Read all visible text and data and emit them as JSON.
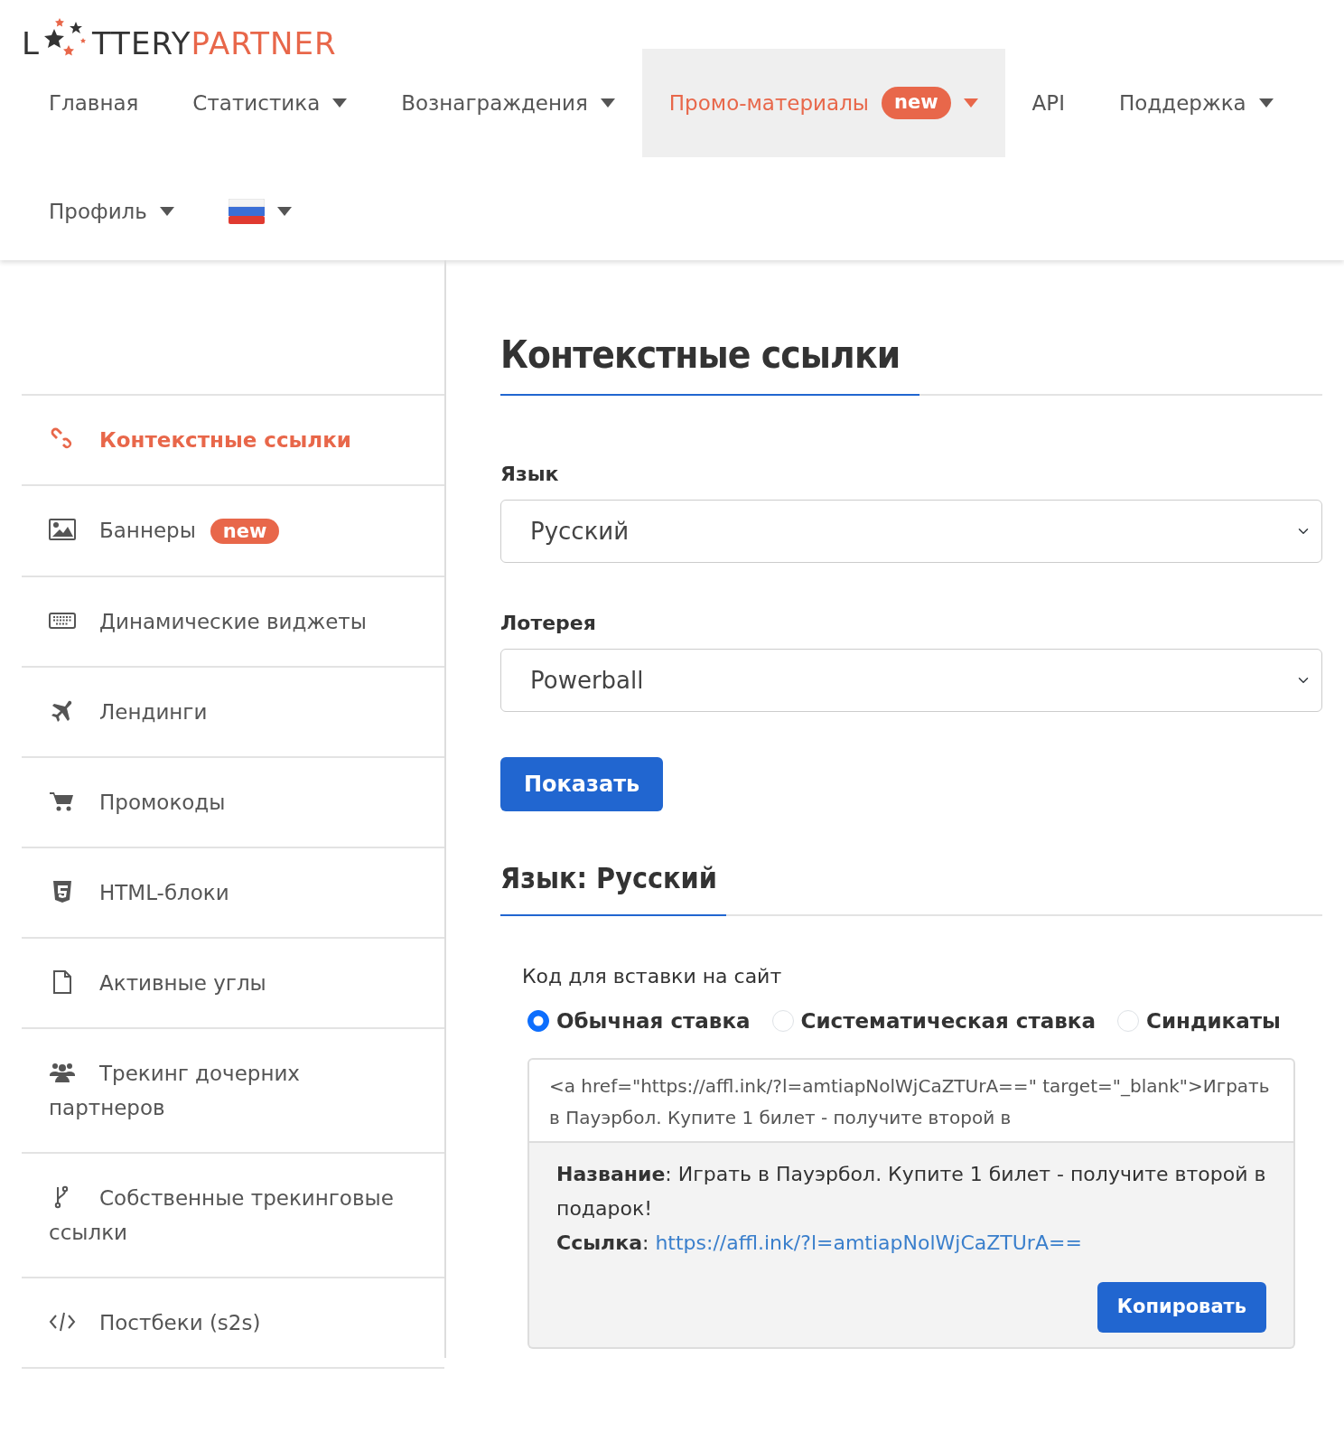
{
  "logo": {
    "part_1": "L",
    "part_2": "TTERY",
    "part_3": "PARTNER"
  },
  "nav": [
    {
      "kind": "text",
      "label": "Главная",
      "dropdown": false,
      "selected": false
    },
    {
      "kind": "text",
      "label": "Статистика",
      "dropdown": true,
      "selected": false
    },
    {
      "kind": "text",
      "label": "Вознаграждения",
      "dropdown": true,
      "selected": false
    },
    {
      "kind": "text",
      "label": "Промо-материалы",
      "badge": "new",
      "dropdown": true,
      "selected": true
    },
    {
      "kind": "text",
      "label": "API",
      "dropdown": false,
      "selected": false
    },
    {
      "kind": "text",
      "label": "Поддержка",
      "dropdown": true,
      "selected": false
    },
    {
      "kind": "text",
      "label": "Профиль",
      "dropdown": true,
      "selected": false
    },
    {
      "kind": "flag",
      "dropdown": true,
      "selected": false
    }
  ],
  "sidebar": {
    "items": [
      {
        "label": "Контекстные ссылки",
        "selected": true
      },
      {
        "label": "Баннеры",
        "badge": "new",
        "selected": false
      },
      {
        "label": "Динамические виджеты",
        "selected": false
      },
      {
        "label": "Лендинги",
        "selected": false
      },
      {
        "label": "Промокоды",
        "selected": false
      },
      {
        "label": "HTML-блоки",
        "selected": false
      },
      {
        "label": "Активные углы",
        "selected": false
      },
      {
        "label": "Трекинг дочерних партнеров",
        "selected": false
      },
      {
        "label": "Собственные трекинговые ссылки",
        "selected": false
      },
      {
        "label": "Постбеки (s2s)",
        "selected": false
      }
    ]
  },
  "main": {
    "title": "Контекстные ссылки",
    "language_field": {
      "label": "Язык",
      "value": "Русский"
    },
    "lottery_field": {
      "label": "Лотерея",
      "value": "Powerball"
    },
    "show_button": "Показать",
    "section_title": "Язык: Русский",
    "code_label": "Код для вставки на сайт",
    "bet_types": [
      {
        "label": "Обычная ставка",
        "selected": true
      },
      {
        "label": "Систематическая ставка",
        "selected": false
      },
      {
        "label": "Синдикаты",
        "selected": false
      }
    ],
    "code": "<a href=\"https://affl.ink/?l=amtiapNolWjCaZTUrA==\" target=\"_blank\">Играть в Пауэрбол. Купите 1 билет - получите второй в",
    "details": {
      "name": "**Название**: Играть в Пауэрбол. Купите 1 билет - получите второй в подарок!",
      "link_label": "**Ссылка**: ",
      "link": "https://affl.ink/?l=amtiapNolWjCaZTUrA=="
    },
    "copy_button": "Копировать"
  }
}
